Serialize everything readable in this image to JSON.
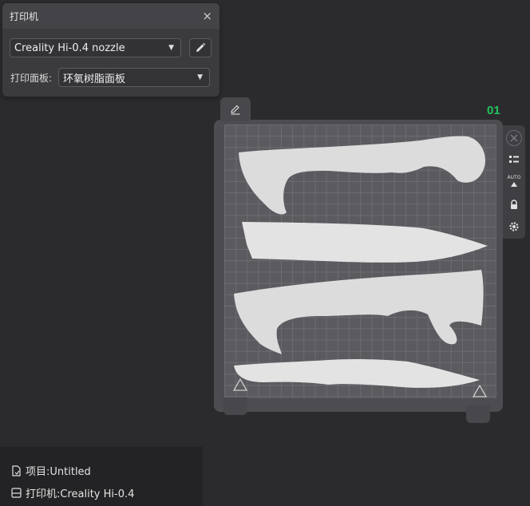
{
  "printer_panel": {
    "title": "打印机",
    "close_label": "×",
    "printer_select": {
      "value": "Creality Hi-0.4 nozzle"
    },
    "plate_label": "打印面板:",
    "plate_select": {
      "value": "环氧树脂面板"
    }
  },
  "build_plate": {
    "plate_number": "01",
    "accent_color": "#22c55e",
    "toolbar_icons": [
      "close-icon",
      "list-icon",
      "auto-arrange-icon",
      "lock-icon",
      "settings-icon"
    ],
    "auto_label": "AUTO"
  },
  "status": {
    "project": "项目:Untitled",
    "printer": "打印机:Creality Hi-0.4"
  }
}
